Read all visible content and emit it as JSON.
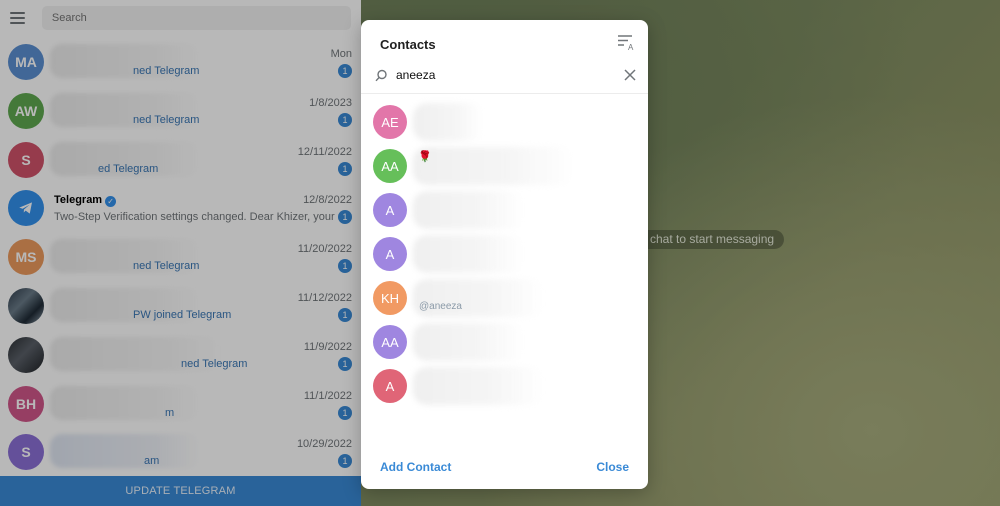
{
  "left_panel": {
    "search_placeholder": "Search",
    "chats": [
      {
        "initials": "MA",
        "color": "#5b8fd1",
        "snippet": "ned Telegram",
        "time": "Mon",
        "unread": "1"
      },
      {
        "initials": "AW",
        "color": "#5fa850",
        "snippet": "ned Telegram",
        "time": "1/8/2023",
        "unread": "1"
      },
      {
        "initials": "S",
        "color": "#d0536a",
        "snippet": "ed Telegram",
        "time": "12/11/2022",
        "unread": "1"
      },
      {
        "initials": "",
        "color": "#3390ec",
        "name": "Telegram",
        "snippet": "Two-Step Verification settings changed. Dear Khizer, your ...",
        "time": "12/8/2022",
        "unread": "1"
      },
      {
        "initials": "MS",
        "color": "#ec9a5e",
        "snippet": "ned Telegram",
        "time": "11/20/2022",
        "unread": "1"
      },
      {
        "initials": "",
        "color": "#3c4b58",
        "snippet": "PW joined Telegram",
        "time": "11/12/2022",
        "unread": "1"
      },
      {
        "initials": "",
        "color": "#3a3f45",
        "snippet": "ned Telegram",
        "time": "11/9/2022",
        "unread": "1"
      },
      {
        "initials": "BH",
        "color": "#d0568a",
        "snippet": "m",
        "time": "11/1/2022",
        "unread": "1"
      },
      {
        "initials": "S",
        "color": "#8b6fd6",
        "snippet": "am",
        "time": "10/29/2022",
        "unread": "1"
      }
    ],
    "update_label": "UPDATE TELEGRAM"
  },
  "chat_area": {
    "hint": "chat to start messaging"
  },
  "contacts_dialog": {
    "title": "Contacts",
    "search_value": "aneeza",
    "contacts": [
      {
        "initials": "AE",
        "color": "#e276a9",
        "sub": ""
      },
      {
        "initials": "AA",
        "color": "#66bf5a",
        "sub": ""
      },
      {
        "initials": "A",
        "color": "#9f86e0",
        "sub": ""
      },
      {
        "initials": "A",
        "color": "#9f86e0",
        "sub": ""
      },
      {
        "initials": "KH",
        "color": "#f19a63",
        "sub": "@aneeza"
      },
      {
        "initials": "AA",
        "color": "#9f86e0",
        "sub": ""
      },
      {
        "initials": "A",
        "color": "#e06577",
        "sub": ""
      }
    ],
    "add_contact_label": "Add Contact",
    "close_label": "Close"
  }
}
